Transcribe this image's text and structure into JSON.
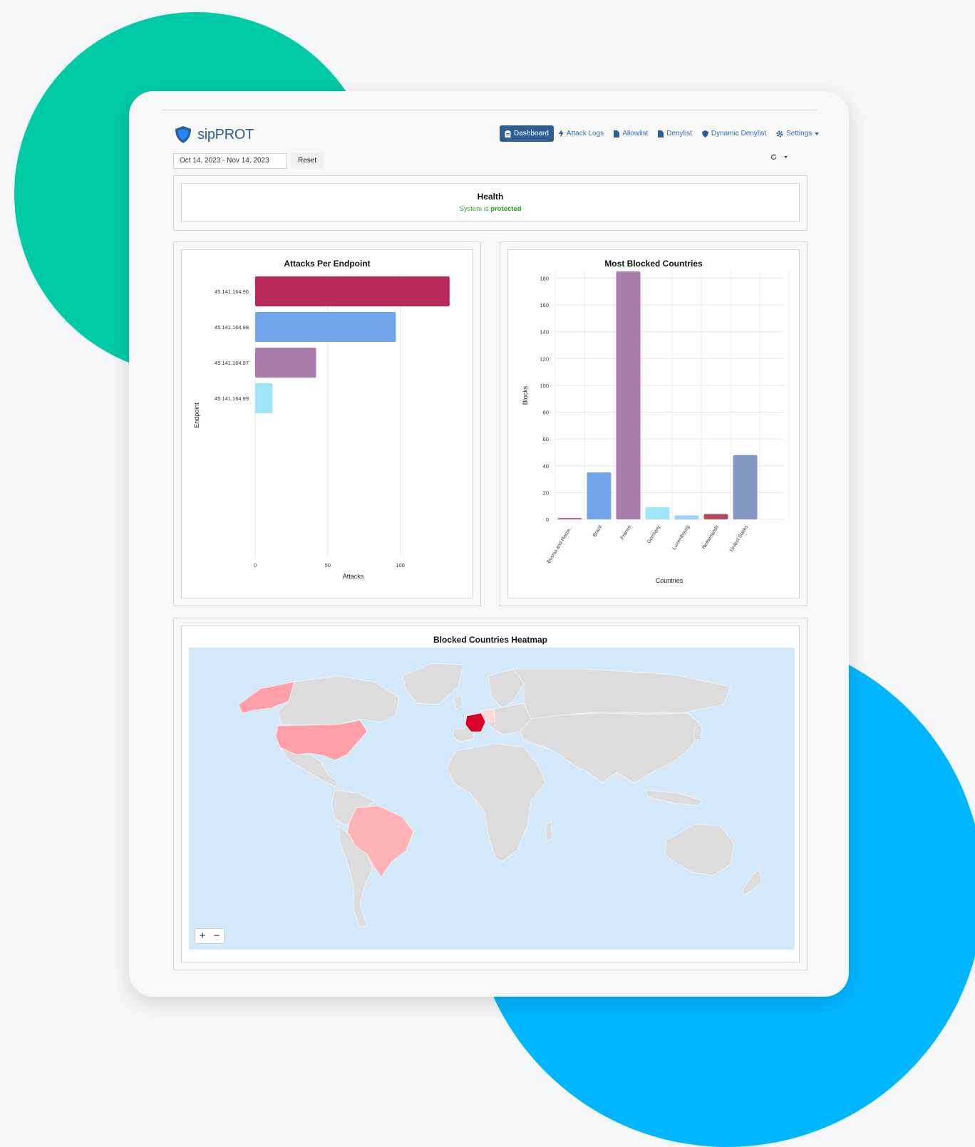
{
  "app": {
    "name": "sipPROT"
  },
  "nav": {
    "items": [
      {
        "label": "Dashboard",
        "icon": "clipboard-icon",
        "active": true
      },
      {
        "label": "Attack Logs",
        "icon": "bolt-icon",
        "active": false
      },
      {
        "label": "Allowlist",
        "icon": "file-icon",
        "active": false
      },
      {
        "label": "Denylist",
        "icon": "file-icon",
        "active": false
      },
      {
        "label": "Dynamic Denylist",
        "icon": "shield-icon",
        "active": false
      },
      {
        "label": "Settings",
        "icon": "gear-icon",
        "active": false,
        "dropdown": true
      }
    ]
  },
  "filters": {
    "date_range": "Oct 14, 2023 - Nov 14, 2023",
    "reset_label": "Reset"
  },
  "health": {
    "title": "Health",
    "status_prefix": "System is",
    "status_value": "protected",
    "status_color": "#23a323"
  },
  "colors": {
    "brand": "#2c5f95",
    "accent_green": "#00cba6",
    "accent_blue": "#00b7ff"
  },
  "chart_data": [
    {
      "type": "bar",
      "orientation": "horizontal",
      "title": "Attacks Per Endpoint",
      "xlabel": "Attacks",
      "ylabel": "Endpoint",
      "categories": [
        "45.141.164.96",
        "45.141.164.98",
        "45.141.164.97",
        "45.141.164.99"
      ],
      "values": [
        134,
        97,
        42,
        12
      ],
      "colors": [
        "#b8295a",
        "#72a4e8",
        "#a97cab",
        "#9ee5f7"
      ],
      "xticks": [
        0,
        50,
        100
      ],
      "xlim": [
        0,
        140
      ],
      "grid": true
    },
    {
      "type": "bar",
      "title": "Most Blocked Countries",
      "xlabel": "Countries",
      "ylabel": "Blocks",
      "categories": [
        "Bosnia and Herze...",
        "Brazil",
        "France",
        "Germany",
        "Luxembourg",
        "Netherlands",
        "United States"
      ],
      "values": [
        1,
        35,
        185,
        9,
        3,
        4,
        48
      ],
      "colors": [
        "#c94d75",
        "#72a4e8",
        "#a97cab",
        "#9ee5f7",
        "#a6cdf2",
        "#b34a5c",
        "#8297c4"
      ],
      "yticks": [
        0,
        20,
        40,
        60,
        80,
        100,
        120,
        140,
        160,
        180
      ],
      "ylim": [
        0,
        185
      ],
      "grid": true
    }
  ],
  "heatmap": {
    "title": "Blocked Countries Heatmap",
    "zoom_in": "+",
    "zoom_out": "−",
    "highlighted": [
      {
        "country": "France",
        "color": "#d9002c"
      },
      {
        "country": "United States",
        "color": "#ff9fa8"
      },
      {
        "country": "Brazil",
        "color": "#ffb3b8"
      },
      {
        "country": "Germany",
        "color": "#ffdcd8"
      }
    ]
  }
}
